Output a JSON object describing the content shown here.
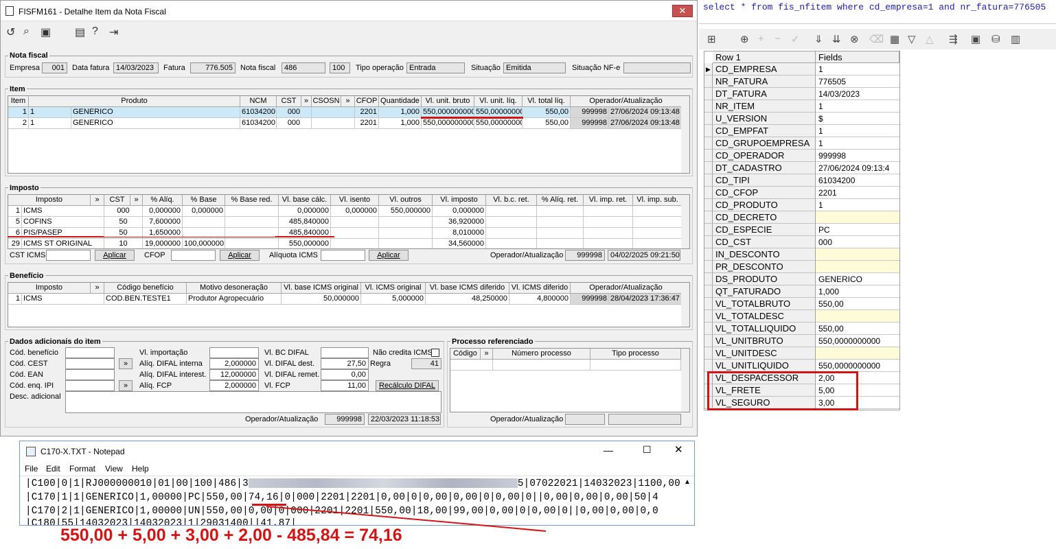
{
  "window": {
    "title": "FISFM161 - Detalhe Item da Nota Fiscal",
    "close": "✕"
  },
  "nota": {
    "group": "Nota fiscal",
    "empresa_label": "Empresa",
    "empresa": "001",
    "data_fatura_label": "Data fatura",
    "data_fatura": "14/03/2023",
    "fatura_label": "Fatura",
    "fatura": "776.505",
    "nota_label": "Nota fiscal",
    "nota": "486",
    "serie": "100",
    "tipo_label": "Tipo operação",
    "tipo": "Entrada",
    "situacao_label": "Situação",
    "situacao": "Emitida",
    "situacao_nfe_label": "Situação NF-e",
    "situacao_nfe": ""
  },
  "item": {
    "group": "Item",
    "headers": [
      "Item",
      "Produto",
      "NCM",
      "CST",
      "»",
      "CSOSN",
      "»",
      "CFOP",
      "Quantidade",
      "Vl. unit. bruto",
      "Vl. unit. líq.",
      "Vl. total líq.",
      "Operador/Atualização"
    ],
    "rows": [
      {
        "item": "1",
        "cod": "1",
        "produto": "GENERICO",
        "ncm": "61034200",
        "cst": "000",
        "csosn": "",
        "cfop": "2201",
        "qtd": "1,000",
        "bruto": "550,000000000",
        "liq": "550,00000000",
        "total": "550,00",
        "op": "999998",
        "at": "27/06/2024 09:13:48"
      },
      {
        "item": "2",
        "cod": "1",
        "produto": "GENERICO",
        "ncm": "61034200",
        "cst": "000",
        "csosn": "",
        "cfop": "2201",
        "qtd": "1,000",
        "bruto": "550,000000000",
        "liq": "550,00000000",
        "total": "550,00",
        "op": "999998",
        "at": "27/06/2024 09:13:48"
      }
    ]
  },
  "imposto": {
    "group": "Imposto",
    "headers": [
      "Imposto",
      "»",
      "CST",
      "»",
      "% Alíq.",
      "% Base",
      "% Base red.",
      "Vl. base cálc.",
      "Vl. isento",
      "Vl. outros",
      "Vl. imposto",
      "Vl. b.c. ret.",
      "% Alíq. ret.",
      "Vl. imp. ret.",
      "Vl. imp. sub."
    ],
    "rows": [
      {
        "id": "1",
        "nome": "ICMS",
        "cst": "000",
        "aliq": "0,000000",
        "base": "0,000000",
        "red": "",
        "bc": "0,000000",
        "isento": "0,000000",
        "outros": "550,000000",
        "imp": "0,000000"
      },
      {
        "id": "5",
        "nome": "COFINS",
        "cst": "50",
        "aliq": "7,600000",
        "base": "",
        "red": "",
        "bc": "485,840000",
        "isento": "",
        "outros": "",
        "imp": "36,920000"
      },
      {
        "id": "6",
        "nome": "PIS/PASEP",
        "cst": "50",
        "aliq": "1,650000",
        "base": "",
        "red": "",
        "bc": "485,840000",
        "isento": "",
        "outros": "",
        "imp": "8,010000"
      },
      {
        "id": "29",
        "nome": "ICMS ST ORIGINAL",
        "cst": "10",
        "aliq": "19,000000",
        "base": "100,000000",
        "red": "",
        "bc": "550,000000",
        "isento": "",
        "outros": "",
        "imp": "34,560000"
      }
    ],
    "cst_icms_label": "CST ICMS",
    "cfop_label": "CFOP",
    "aliq_icms_label": "Alíquota ICMS",
    "aplicar": "Aplicar",
    "op_label": "Operador/Atualização",
    "op": "999998",
    "at": "04/02/2025 09:21:50"
  },
  "beneficio": {
    "group": "Benefício",
    "headers": [
      "Imposto",
      "»",
      "Código benefício",
      "Motivo desoneração",
      "Vl. base ICMS original",
      "Vl. ICMS original",
      "Vl. base ICMS diferido",
      "Vl. ICMS diferido",
      "Operador/Atualização"
    ],
    "row": {
      "id": "1",
      "nome": "ICMS",
      "codigo": "COD.BEN.TESTE1",
      "motivo": "Produtor Agropecuário",
      "base_orig": "50,000000",
      "icms_orig": "5,000000",
      "base_dif": "48,250000",
      "icms_dif": "4,800000",
      "op": "999998",
      "at": "28/04/2023 17:36:47"
    }
  },
  "dados": {
    "group": "Dados adicionais do item",
    "cod_beneficio": "Cód. benefício",
    "cod_cest": "Cód. CEST",
    "cod_ean": "Cód. EAN",
    "cod_enq": "Cód. enq. IPI",
    "desc": "Desc. adicional",
    "vl_import": "Vl. importação",
    "aliq_difal_int": "Alíq. DIFAL interna",
    "aliq_difal_int_v": "2,000000",
    "aliq_difal_inter": "Alíq. DIFAL interest.",
    "aliq_difal_inter_v": "12,000000",
    "aliq_fcp": "Alíq. FCP",
    "aliq_fcp_v": "2,000000",
    "vl_bc_difal": "Vl. BC DIFAL",
    "vl_bc_difal_v": "",
    "vl_difal_dest": "Vl. DIFAL dest.",
    "vl_difal_dest_v": "27,50",
    "vl_difal_remet": "Vl. DIFAL remet.",
    "vl_difal_remet_v": "0,00",
    "vl_fcp": "Vl. FCP",
    "vl_fcp_v": "11,00",
    "nao_credita": "Não credita ICMS",
    "regra": "Regra",
    "regra_v": "41",
    "recalc": "Recálculo DIFAL",
    "arrow": "»",
    "op_label": "Operador/Atualização",
    "op": "999998",
    "at": "22/03/2023 11:18:53"
  },
  "processo": {
    "group": "Processo referenciado",
    "headers": [
      "Código",
      "»",
      "Número processo",
      "Tipo processo"
    ],
    "op_label": "Operador/Atualização"
  },
  "sql": "select * from fis_nfitem where cd_empresa=1 and nr_fatura=776505",
  "record": {
    "header_row": "Row 1",
    "header_fields": "Fields",
    "rows": [
      {
        "k": "CD_EMPRESA",
        "v": "1"
      },
      {
        "k": "NR_FATURA",
        "v": "776505"
      },
      {
        "k": "DT_FATURA",
        "v": "14/03/2023"
      },
      {
        "k": "NR_ITEM",
        "v": "1"
      },
      {
        "k": "U_VERSION",
        "v": "$"
      },
      {
        "k": "CD_EMPFAT",
        "v": "1"
      },
      {
        "k": "CD_GRUPOEMPRESA",
        "v": "1"
      },
      {
        "k": "CD_OPERADOR",
        "v": "999998"
      },
      {
        "k": "DT_CADASTRO",
        "v": "27/06/2024 09:13:4"
      },
      {
        "k": "CD_TIPI",
        "v": "61034200"
      },
      {
        "k": "CD_CFOP",
        "v": "2201"
      },
      {
        "k": "CD_PRODUTO",
        "v": "1"
      },
      {
        "k": "CD_DECRETO",
        "v": ""
      },
      {
        "k": "CD_ESPECIE",
        "v": "PC"
      },
      {
        "k": "CD_CST",
        "v": "000"
      },
      {
        "k": "IN_DESCONTO",
        "v": ""
      },
      {
        "k": "PR_DESCONTO",
        "v": ""
      },
      {
        "k": "DS_PRODUTO",
        "v": "GENERICO"
      },
      {
        "k": "QT_FATURADO",
        "v": "1,000"
      },
      {
        "k": "VL_TOTALBRUTO",
        "v": "550,00"
      },
      {
        "k": "VL_TOTALDESC",
        "v": ""
      },
      {
        "k": "VL_TOTALLIQUIDO",
        "v": "550,00"
      },
      {
        "k": "VL_UNITBRUTO",
        "v": "550,0000000000"
      },
      {
        "k": "VL_UNITDESC",
        "v": ""
      },
      {
        "k": "VL_UNITLIQUIDO",
        "v": "550,0000000000"
      },
      {
        "k": "VL_DESPACESSOR",
        "v": "2,00"
      },
      {
        "k": "VL_FRETE",
        "v": "5,00"
      },
      {
        "k": "VL_SEGURO",
        "v": "3,00"
      }
    ]
  },
  "notepad": {
    "title": "C170-X.TXT - Notepad",
    "menu": [
      "File",
      "Edit",
      "Format",
      "View",
      "Help"
    ],
    "line1a": "|C100|0|1|RJ000000010|01|00|100|486|3",
    "line1b": "5|07022021|14032023|1100,00",
    "line2": "|C170|1|1|GENERICO|1,00000|PC|550,00|74,16|0|000|2201|2201|0,00|0|0,00|0,00|0|0,00|0||0,00|0,00|0,00|50|4",
    "line3": "|C170|2|1|GENERICO|1,00000|UN|550,00|0,00|0|000|2201|2201|550,00|18,00|99,00|0,00|0|0,00|0||0,00|0,00|0,0",
    "line4": "|C180|55|14032023|14032023|1|29031400||41,87|"
  },
  "formula": "550,00 + 5,00 + 3,00 + 2,00 - 485,84 = 74,16"
}
